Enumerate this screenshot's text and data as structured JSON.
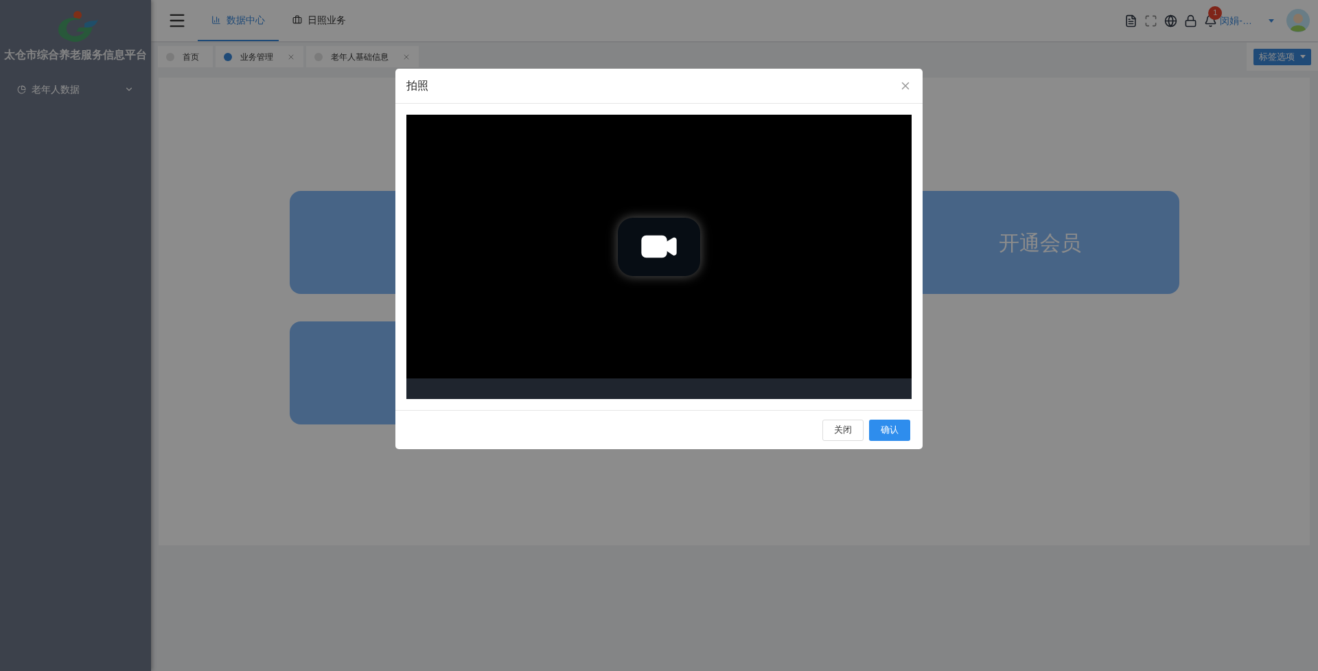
{
  "sidebar": {
    "platform_name": "太仓市综合养老服务信息平台",
    "menu": [
      {
        "label": "老年人数据",
        "expanded": false
      }
    ]
  },
  "header": {
    "nav": [
      {
        "label": "数据中心",
        "selected": true
      },
      {
        "label": "日照业务",
        "selected": false
      }
    ],
    "notification_count": "1",
    "user_name": "闵娟-…"
  },
  "page_tabs": [
    {
      "label": "首页",
      "selected": false,
      "closable": false
    },
    {
      "label": "业务管理",
      "selected": true,
      "closable": true
    },
    {
      "label": "老年人基础信息",
      "selected": false,
      "closable": true
    }
  ],
  "tab_options_button": "标签选项",
  "cards": [
    {
      "label": "开通会员"
    }
  ],
  "dialog": {
    "title": "拍照",
    "buttons": [
      {
        "label": "关闭",
        "kind": "default"
      },
      {
        "label": "确认",
        "kind": "primary"
      }
    ]
  }
}
